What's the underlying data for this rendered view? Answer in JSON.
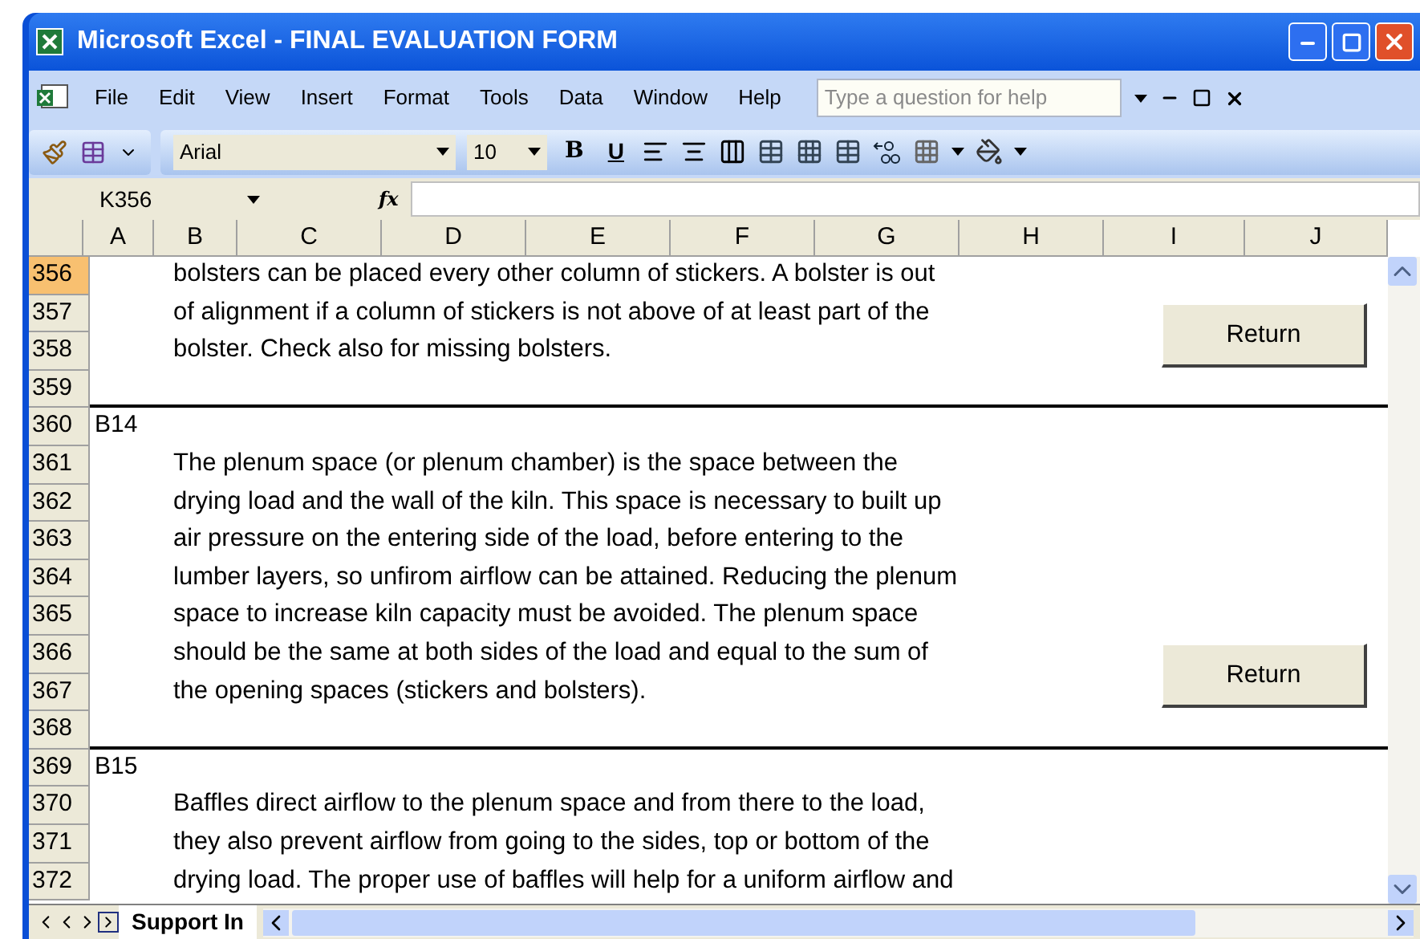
{
  "window": {
    "title": "Microsoft Excel - FINAL EVALUATION FORM"
  },
  "menu": [
    "File",
    "Edit",
    "View",
    "Insert",
    "Format",
    "Tools",
    "Data",
    "Window",
    "Help"
  ],
  "help_box": {
    "placeholder": "Type a question for help"
  },
  "toolbar": {
    "font": "Arial",
    "size": "10",
    "bold": "B",
    "underline": "U"
  },
  "formula_bar": {
    "name_box": "K356",
    "function_label": "fx"
  },
  "columns": [
    {
      "label": "A"
    },
    {
      "label": "B"
    },
    {
      "label": "C"
    },
    {
      "label": "D"
    },
    {
      "label": "E"
    },
    {
      "label": "F"
    },
    {
      "label": "G"
    },
    {
      "label": "H"
    },
    {
      "label": "I"
    },
    {
      "label": "J"
    }
  ],
  "rows": [
    {
      "number": "356",
      "selected": true,
      "text": "bolsters can be placed every other column of stickers. A bolster is out"
    },
    {
      "number": "357",
      "selected": false,
      "text": "of alignment if a column of stickers is not above of at least part of the"
    },
    {
      "number": "358",
      "selected": false,
      "text": "bolster. Check also for missing bolsters.",
      "button": "Return"
    },
    {
      "number": "359",
      "selected": false,
      "section_end": true
    },
    {
      "number": "360",
      "selected": false,
      "label": "B14"
    },
    {
      "number": "361",
      "selected": false,
      "text": "The plenum space (or plenum chamber) is the space between the"
    },
    {
      "number": "362",
      "selected": false,
      "text": "drying load and the wall of the kiln. This space is necessary to built up"
    },
    {
      "number": "363",
      "selected": false,
      "text": "air pressure on the entering side of the load, before entering to the"
    },
    {
      "number": "364",
      "selected": false,
      "text": "lumber layers, so unfirom airflow can be attained. Reducing the plenum"
    },
    {
      "number": "365",
      "selected": false,
      "text": "space to increase kiln capacity must be avoided. The plenum space"
    },
    {
      "number": "366",
      "selected": false,
      "text": "should be the same at both sides of the load and equal to the sum of"
    },
    {
      "number": "367",
      "selected": false,
      "text": "the opening spaces (stickers and bolsters).",
      "button": "Return"
    },
    {
      "number": "368",
      "selected": false,
      "section_end": true
    },
    {
      "number": "369",
      "selected": false,
      "label": "B15"
    },
    {
      "number": "370",
      "selected": false,
      "text": "Baffles direct airflow to the plenum space and from there to the load,"
    },
    {
      "number": "371",
      "selected": false,
      "text": "they also prevent airflow from going to the sides, top or bottom of the"
    },
    {
      "number": "372",
      "selected": false,
      "text": "drying load. The proper use of baffles will help for a uniform airflow and"
    }
  ],
  "sheet_tabs": [
    {
      "label": "Support In",
      "selected": true
    }
  ]
}
